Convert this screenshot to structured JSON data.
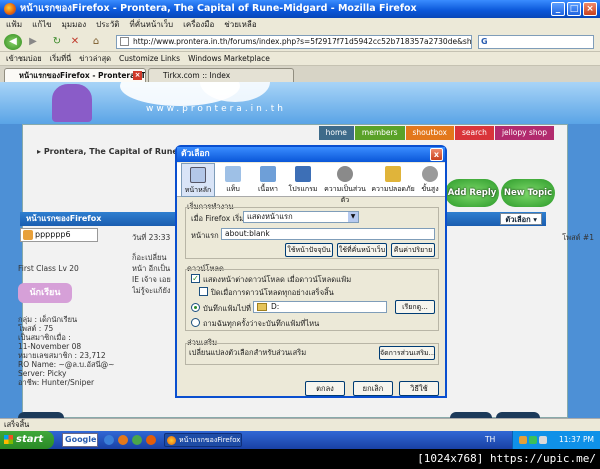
{
  "window": {
    "title": "หน้าแรกของFirefox - Prontera, The Capital of Rune-Midgard - Mozilla Firefox",
    "controls": [
      "_",
      "□",
      "×"
    ]
  },
  "menubar": [
    "แฟ้ม",
    "แก้ไข",
    "มุมมอง",
    "ประวัติ",
    "ที่คั่นหน้าเว็บ",
    "เครื่องมือ",
    "ช่วยเหลือ"
  ],
  "navbar": {
    "url": "http://www.prontera.in.th/forums/index.php?s=5f2917f71d5942cc52b718357a2730de&showtopic=21161",
    "search_engine": "G"
  },
  "bookmarks": [
    "เข้าชมบ่อย",
    "เริ่มที่นี่",
    "ข่าวล่าสุด",
    "Customize Links",
    "Windows Marketplace"
  ],
  "tabs": [
    {
      "label": "หน้าแรกของFirefox - Prontera, Th..."
    },
    {
      "label": "Tirkx.com :: Index"
    }
  ],
  "page": {
    "brand_text": "www.prontera.in.th",
    "nav": [
      "home",
      "members",
      "shoutbox",
      "search",
      "jellopy shop"
    ],
    "forum_title": "Prontera, The Capital of Rune-Midgard",
    "add_reply": "Add Reply",
    "new_topic": "New Topic",
    "post_header": "หน้าแรกของFirefox",
    "options_label": "ตัวเลือก ▾",
    "username": "pppppp6",
    "post_date": "วันที่ 23:33",
    "post_num": "โพสต์ #1",
    "post_text": "ก็อะเปลี่ยนหน้า อีกเป็น IE เจ้าจ เอยไม่รู้จะแก้ยัง",
    "user_info": {
      "rank": "First Class Lv 20",
      "badge": "นักเรียน",
      "group": "กลุ่ม : เด็กนักเรียน",
      "posts": "โพสต์ : 75",
      "member_since": "เป็นสมาชิกเมื่อ :",
      "joined": "11-November 08",
      "member_no": "หมายเลขสมาชิก : 23,712",
      "ro_name": "RO Name: ~@ล.บ.อัสนี@~",
      "server": "Server: Picky",
      "job": "อาชีพ: Hunter/Sniper"
    }
  },
  "dialog": {
    "title": "ตัวเลือก",
    "close": "x",
    "tabs": [
      {
        "label": "หน้าหลัก",
        "icon": "main-icon"
      },
      {
        "label": "แท็บ",
        "icon": "tabs-icon"
      },
      {
        "label": "เนื้อหา",
        "icon": "content-icon"
      },
      {
        "label": "โปรแกรม",
        "icon": "applications-icon"
      },
      {
        "label": "ความเป็นส่วนตัว",
        "icon": "privacy-icon"
      },
      {
        "label": "ความปลอดภัย",
        "icon": "security-icon"
      },
      {
        "label": "ขั้นสูง",
        "icon": "advanced-icon"
      }
    ],
    "startup": {
      "section": "เริ่มการทำงาน",
      "when_starts_label": "เมื่อ Firefox เริ่ม :",
      "when_starts_value": "แสดงหน้าแรก",
      "homepage_label": "หน้าแรก :",
      "homepage_value": "about:blank",
      "btn_current": "ใช้หน้าปัจจุบัน",
      "btn_bookmark": "ใช้ที่คั่นหน้าเว็บ",
      "btn_default": "คืนค่าปริยาย"
    },
    "downloads": {
      "section": "ดาวน์โหลด",
      "show_window": "แสดงหน้าต่างดาวน์โหลด เมื่อดาวน์โหลดแฟ้ม",
      "close_when_done": "ปิดเมื่อการดาวน์โหลดทุกอย่างเสร็จสิ้น",
      "save_to_label": "บันทึกแฟ้มไปที่",
      "save_to_path": "D:",
      "browse": "เรียกดู...",
      "always_ask": "ถามฉันทุกครั้งว่าจะบันทึกแฟ้มที่ไหน"
    },
    "addons": {
      "section": "ส่วนเสริม",
      "description": "เปลี่ยนแปลงตัวเลือกสำหรับส่วนเสริม",
      "manage": "จัดการส่วนเสริม..."
    },
    "buttons": {
      "ok": "ตกลง",
      "cancel": "ยกเลิก",
      "help": "วิธีใช้"
    }
  },
  "statusbar": {
    "text": "เสร็จสิ้น"
  },
  "taskbar": {
    "start": "start",
    "google": "Google",
    "task": "หน้าแรกของFirefox - ...",
    "lang": "TH",
    "clock": "11:37 PM"
  },
  "watermark": "[1024x768] https://upic.me/"
}
